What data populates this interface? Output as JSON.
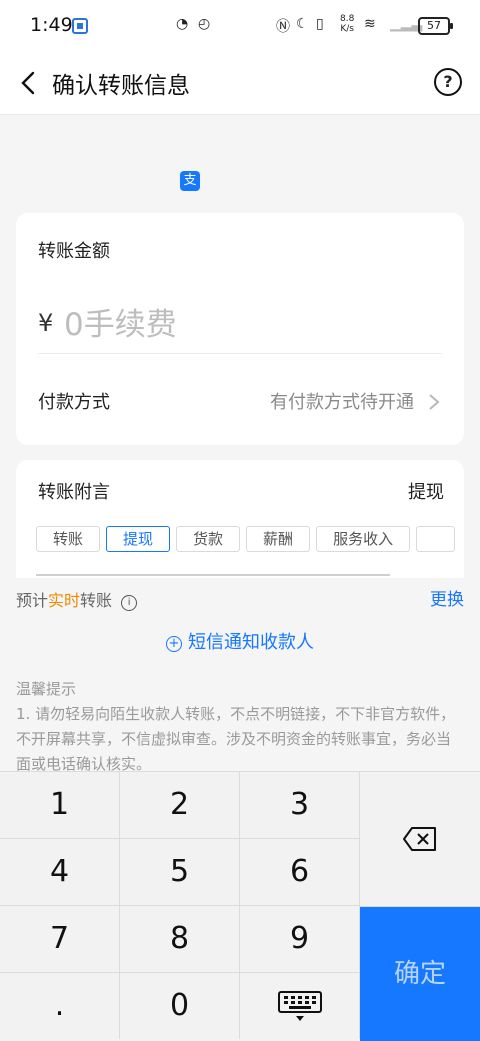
{
  "status": {
    "time": "1:49",
    "speed_value": "8.8",
    "speed_unit": "K/s",
    "battery": "57"
  },
  "header": {
    "title": "确认转账信息"
  },
  "amount_card": {
    "label": "转账金额",
    "currency": "¥",
    "placeholder": "0手续费",
    "payment_label": "付款方式",
    "payment_value": "有付款方式待开通"
  },
  "remark_card": {
    "label": "转账附言",
    "selected": "提现",
    "chips": [
      "转账",
      "提现",
      "货款",
      "薪酬",
      "服务收入"
    ]
  },
  "estimate": {
    "prefix": "预计",
    "highlight": "实时",
    "suffix": "转账",
    "change": "更换"
  },
  "sms": {
    "label": "短信通知收款人"
  },
  "tips": {
    "title": "温馨提示",
    "body": "1. 请勿轻易向陌生收款人转账，不点不明链接，不下非官方软件，不开屏幕共享，不信虚拟审查。涉及不明资金的转账事宜，务必当面或电话确认核实。"
  },
  "keypad": {
    "keys": [
      "1",
      "2",
      "3",
      "4",
      "5",
      "6",
      "7",
      "8",
      "9",
      ".",
      "0"
    ],
    "confirm": "确定"
  },
  "colors": {
    "accent": "#1677ff",
    "highlight": "#f08a00"
  },
  "icons": [
    "back-icon",
    "help-icon",
    "alipay-logo-icon",
    "chevron-right-icon",
    "info-icon",
    "plus-circle-icon",
    "backspace-icon",
    "keyboard-icon"
  ]
}
